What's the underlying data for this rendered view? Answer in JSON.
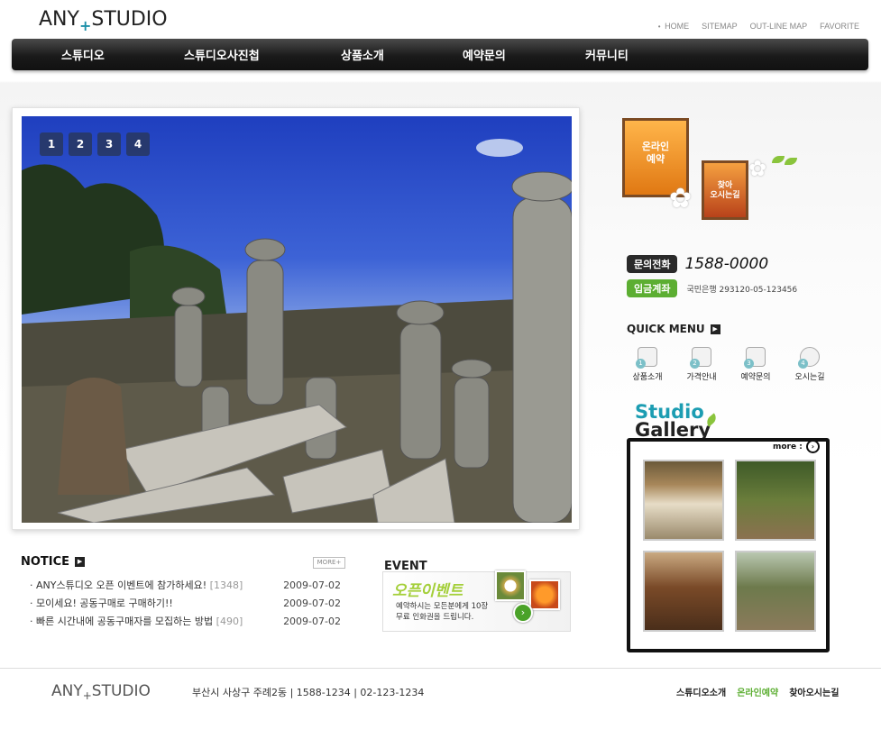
{
  "header": {
    "logo_left": "ANY",
    "logo_plus": "+",
    "logo_right": "STUDIO",
    "top_links": [
      "HOME",
      "SITEMAP",
      "OUT-LINE MAP",
      "FAVORITE"
    ],
    "nav": [
      "스튜디오",
      "스튜디오사진첩",
      "상품소개",
      "예약문의",
      "커뮤니티"
    ]
  },
  "hero": {
    "pages": [
      "1",
      "2",
      "3",
      "4"
    ]
  },
  "banner": {
    "reservation_line1": "온라인",
    "reservation_line2": "예약",
    "directions_line1": "찾아",
    "directions_line2": "오시는길"
  },
  "contact": {
    "phone_label": "문의전화",
    "phone": "1588-0000",
    "account_label": "입금계좌",
    "account": "국민은행 293120-05-123456"
  },
  "quick_menu": {
    "title": "QUICK MENU",
    "items": [
      {
        "num": "1",
        "label": "상품소개"
      },
      {
        "num": "2",
        "label": "가격안내"
      },
      {
        "num": "3",
        "label": "예약문의"
      },
      {
        "num": "4",
        "label": "오시는길"
      }
    ]
  },
  "gallery": {
    "title_1": "Studio",
    "title_2": "Gallery",
    "more": "more :"
  },
  "notice": {
    "title": "NOTICE",
    "more": "MORE+",
    "items": [
      {
        "text": "ANY스튜디오 오픈 이벤트에 참가하세요!",
        "count": "[1348]",
        "date": "2009-07-02"
      },
      {
        "text": "모이세요! 공동구매로 구매하기!!",
        "count": "",
        "date": "2009-07-02"
      },
      {
        "text": "빠른 시간내에 공동구매자를 모집하는 방법",
        "count": "[490]",
        "date": "2009-07-02"
      }
    ]
  },
  "event": {
    "title": "EVENT",
    "headline": "오픈이벤트",
    "desc_line1": "예약하시는 모든분에게 10장",
    "desc_line2": "무료 인화권을 드립니다."
  },
  "footer": {
    "logo_left": "ANY",
    "logo_plus": "+",
    "logo_right": "STUDIO",
    "address": "부산시 사상구 주례2동 | 1588-1234 | 02-123-1234",
    "links": [
      "스튜디오소개",
      "온라인예약",
      "찾아오시는길"
    ]
  }
}
